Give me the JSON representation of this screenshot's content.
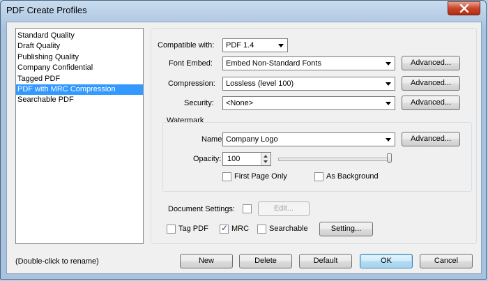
{
  "window": {
    "title": "PDF Create Profiles",
    "close_icon": "close-icon"
  },
  "profiles": {
    "items": [
      "Standard Quality",
      "Draft Quality",
      "Publishing Quality",
      "Company Confidential",
      "Tagged PDF",
      "PDF with MRC Compression",
      "Searchable PDF"
    ],
    "selected": "PDF with MRC Compression",
    "hint": "(Double-click to rename)"
  },
  "settings": {
    "compatible_label": "Compatible with:",
    "compatible_value": "PDF 1.4",
    "font_embed_label": "Font Embed:",
    "font_embed_value": "Embed Non-Standard Fonts",
    "compression_label": "Compression:",
    "compression_value": "Lossless (level 100)",
    "security_label": "Security:",
    "security_value": "<None>",
    "advanced_label": "Advanced..."
  },
  "watermark": {
    "group_label": "Watermark",
    "name_label": "Name:",
    "name_value": "Company Logo",
    "opacity_label": "Opacity:",
    "opacity_value": "100",
    "opacity_level_percent": 100,
    "first_page_only_label": "First Page Only",
    "first_page_only_checked": false,
    "as_background_label": "As Background",
    "as_background_checked": false
  },
  "document": {
    "settings_label": "Document Settings:",
    "settings_checked": false,
    "edit_label": "Edit...",
    "tag_pdf_label": "Tag PDF",
    "tag_pdf_checked": false,
    "mrc_label": "MRC",
    "mrc_checked": true,
    "searchable_label": "Searchable",
    "searchable_checked": false,
    "setting_button_label": "Setting..."
  },
  "buttons": {
    "new": "New",
    "delete": "Delete",
    "default": "Default",
    "ok": "OK",
    "cancel": "Cancel"
  }
}
